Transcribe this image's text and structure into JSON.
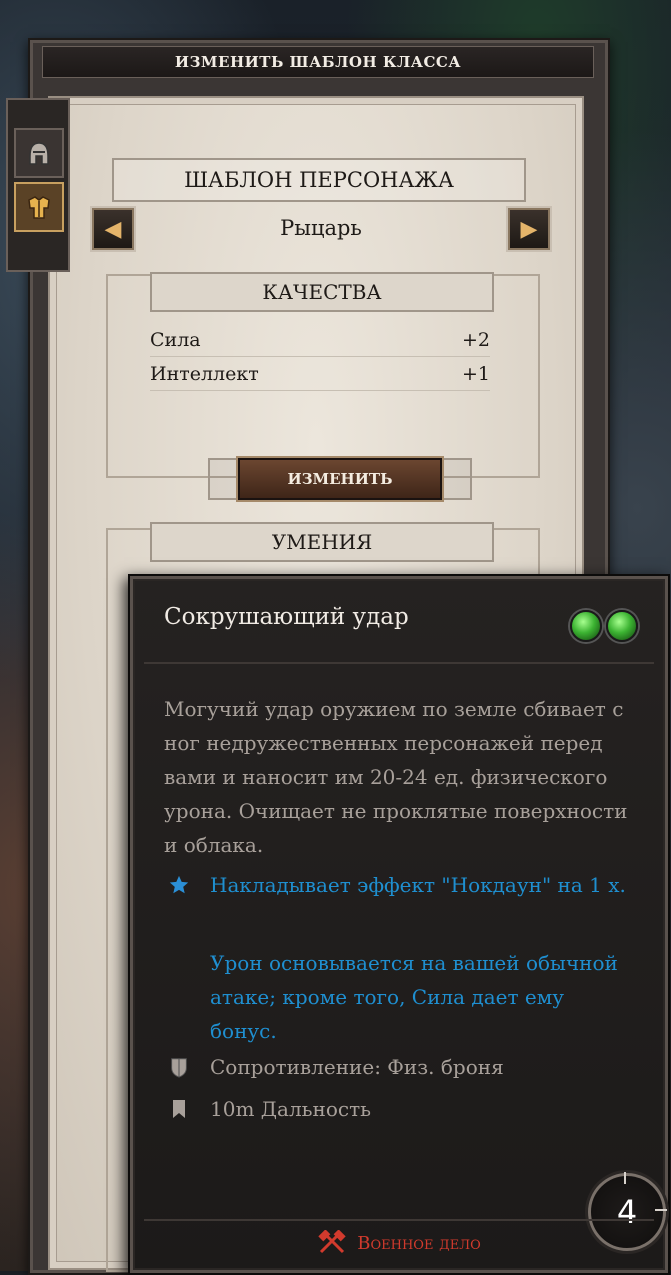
{
  "window": {
    "title": "ИЗМЕНИТЬ ШАБЛОН КЛАССА"
  },
  "side_tabs": [
    {
      "icon": "helmet-icon",
      "active": false
    },
    {
      "icon": "armor-icon",
      "active": true
    }
  ],
  "template": {
    "header": "ШАБЛОН ПЕРСОНАЖА",
    "selected": "Рыцарь",
    "prev_icon": "arrow-left-icon",
    "next_icon": "arrow-right-icon"
  },
  "qualities": {
    "header": "КАЧЕСТВА",
    "items": [
      {
        "name": "Сила",
        "value": "+2"
      },
      {
        "name": "Интеллект",
        "value": "+1"
      }
    ],
    "change_label": "ИЗМЕНИТЬ"
  },
  "skills": {
    "header": "УМЕНИЯ"
  },
  "tooltip": {
    "title": "Сокрушающий удар",
    "action_points": 2,
    "description": "Могучий удар оружием по земле сбивает с ног недружественных персонажей перед вами и наносит им 20-24 ед. физического урона. Очищает не проклятые поверхности и облака.",
    "effect": "Накладывает эффект \"Нокдаун\" на 1 х.",
    "damage_note": "Урон основывается на вашей обычной атаке; кроме того, Сила дает ему бонус.",
    "resistance": "Сопротивление: Физ. броня",
    "range": "10m  Дальность",
    "school": "Военное дело",
    "cooldown": "4",
    "colors": {
      "effect_text": "#1f8fd0",
      "school_text": "#d13a2d",
      "ap_orb": "#3cb332"
    }
  }
}
